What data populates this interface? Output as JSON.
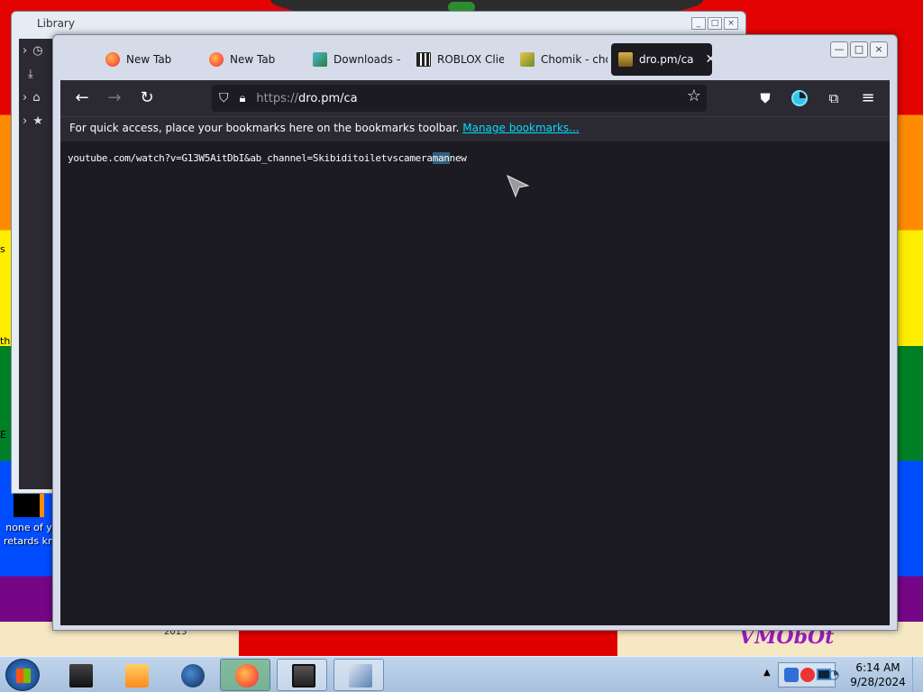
{
  "desktop": {
    "icon_label": "none of y retards kn",
    "left_texts": [
      "s",
      "th",
      "E"
    ],
    "wallpaper_year": "2015",
    "wallpaper_tag": "VMObOt"
  },
  "library": {
    "title": "Library",
    "controls": [
      "_",
      "□",
      "×"
    ]
  },
  "firefox": {
    "tabs": [
      {
        "label": "New Tab",
        "icon": "firefox-icon",
        "color": "#ff6b2b"
      },
      {
        "label": "New Tab",
        "icon": "firefox-icon",
        "color": "#ff6b2b"
      },
      {
        "label": "Downloads –",
        "icon": "downloads-icon",
        "color": "#4bb8d8"
      },
      {
        "label": "ROBLOX Clie",
        "icon": "museum-icon",
        "color": "#222222"
      },
      {
        "label": "Chomik - cho",
        "icon": "chomik-icon",
        "color": "#c9a623"
      },
      {
        "label": "dro.pm/ca",
        "icon": "dropm-icon",
        "color": "#d9b144",
        "active": true
      }
    ],
    "window_controls": [
      "—",
      "□",
      "×"
    ],
    "url": {
      "prefix": "https://",
      "host": "dro.pm/ca"
    },
    "bookmarks_text": "For quick access, place your bookmarks here on the bookmarks toolbar.",
    "manage_bookmarks": "Manage bookmarks...",
    "page": {
      "before": "youtube.com/watch?v=G13W5AitDbI&ab_channel=Skibiditoiletvscamera",
      "highlight": "man",
      "after": "new"
    }
  },
  "taskbar": {
    "time": "6:14 AM",
    "date": "9/28/2024"
  },
  "colors": {
    "accent": "#00ddff",
    "toolbar": "#2b2a33",
    "content": "#1c1b22"
  }
}
